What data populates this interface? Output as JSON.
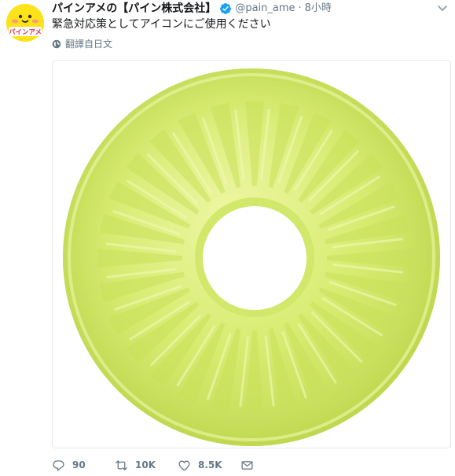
{
  "tweet": {
    "display_name": "パインアメの【パイン株式会社】",
    "handle": "@pain_ame",
    "separator": "·",
    "time": "8小時",
    "text": "緊急対応策としてアイコンにご使用ください",
    "translate_label": "翻譯自日文",
    "avatar_text": "パインアメ",
    "verified_icon": "verified-badge-icon",
    "colors": {
      "accent": "#1da1f2",
      "muted": "#657786",
      "avatar_bg": "#ffe31a",
      "candy": "#d9ee74"
    }
  },
  "actions": {
    "reply_count": "90",
    "retweet_count": "10K",
    "like_count": "8.5K"
  }
}
